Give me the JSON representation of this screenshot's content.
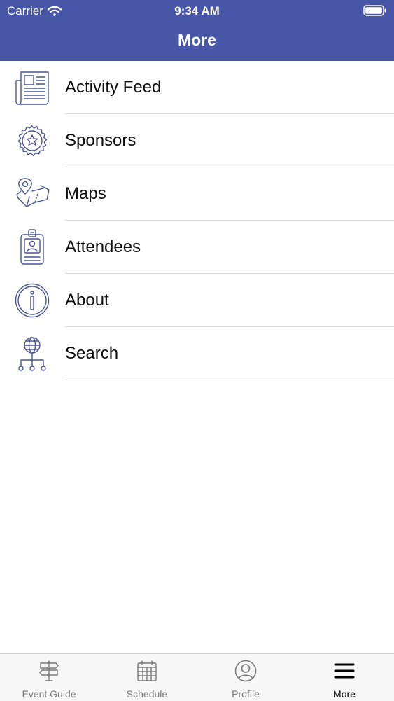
{
  "status_bar": {
    "carrier": "Carrier",
    "time": "9:34 AM"
  },
  "nav": {
    "title": "More"
  },
  "menu": [
    {
      "label": "Activity Feed",
      "icon": "newspaper-icon"
    },
    {
      "label": "Sponsors",
      "icon": "star-badge-icon"
    },
    {
      "label": "Maps",
      "icon": "map-pin-icon"
    },
    {
      "label": "Attendees",
      "icon": "id-badge-icon"
    },
    {
      "label": "About",
      "icon": "info-icon"
    },
    {
      "label": "Search",
      "icon": "globe-network-icon"
    }
  ],
  "tabs": [
    {
      "label": "Event Guide",
      "icon": "signpost-icon",
      "active": false
    },
    {
      "label": "Schedule",
      "icon": "calendar-icon",
      "active": false
    },
    {
      "label": "Profile",
      "icon": "profile-icon",
      "active": false
    },
    {
      "label": "More",
      "icon": "menu-icon",
      "active": true
    }
  ],
  "colors": {
    "header": "#4856a8",
    "icon_stroke": "#4a5596",
    "tab_inactive": "#7a7a7a",
    "tab_active": "#000000"
  }
}
